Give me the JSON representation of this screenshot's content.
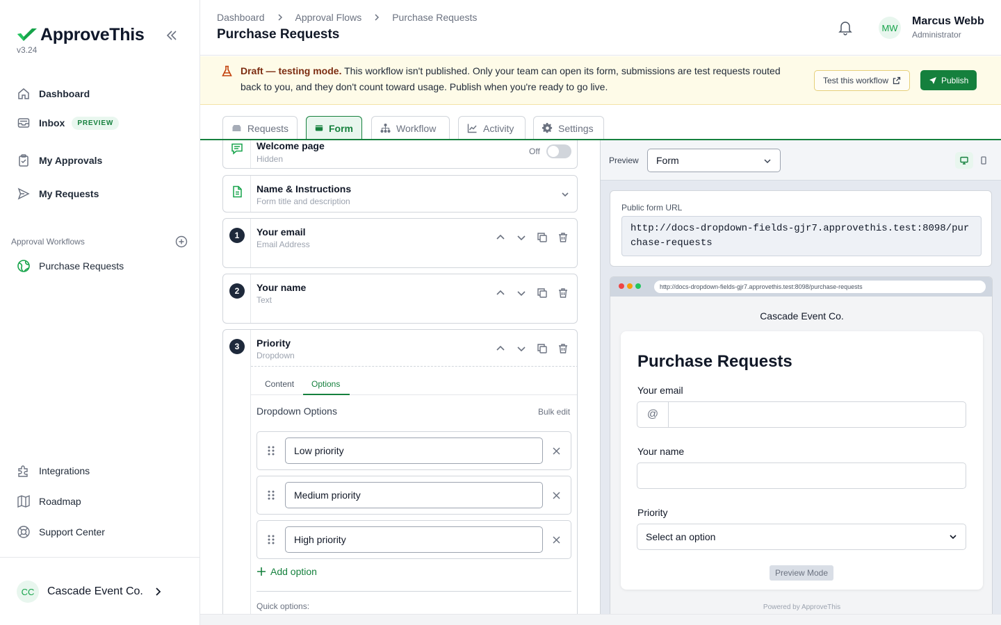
{
  "app": {
    "name": "ApproveThis",
    "version": "v3.24",
    "brand_color": "#15803d"
  },
  "sidebar": {
    "nav": [
      {
        "label": "Dashboard",
        "icon": "home-icon"
      },
      {
        "label": "Inbox",
        "icon": "inbox-icon",
        "badge": "PREVIEW"
      },
      {
        "label": "My Approvals",
        "icon": "clipboard-icon"
      },
      {
        "label": "My Requests",
        "icon": "send-icon"
      }
    ],
    "section_label": "Approval Workflows",
    "workflows": [
      {
        "label": "Purchase Requests",
        "icon": "globe-icon"
      }
    ],
    "bottom_nav": [
      {
        "label": "Integrations",
        "icon": "puzzle-icon"
      },
      {
        "label": "Roadmap",
        "icon": "map-icon"
      },
      {
        "label": "Support Center",
        "icon": "lifebuoy-icon"
      }
    ],
    "org": {
      "initials": "CC",
      "name": "Cascade Event Co."
    }
  },
  "header": {
    "breadcrumbs": [
      "Dashboard",
      "Approval Flows",
      "Purchase Requests"
    ],
    "title": "Purchase Requests",
    "user": {
      "initials": "MW",
      "name": "Marcus Webb",
      "role": "Administrator"
    }
  },
  "banner": {
    "strong": "Draft — testing mode.",
    "text": " This workflow isn't published. Only your team can open its form, submissions are test requests routed back to you, and they don't count toward usage. Publish when you're ready to go live.",
    "test_button": "Test this workflow",
    "publish_button": "Publish"
  },
  "tabs": [
    {
      "label": "Requests",
      "icon": "inbox-tray-icon"
    },
    {
      "label": "Form",
      "icon": "form-icon",
      "active": true
    },
    {
      "label": "Workflow",
      "icon": "workflow-icon"
    },
    {
      "label": "Activity",
      "icon": "chart-line-icon"
    },
    {
      "label": "Settings",
      "icon": "gear-icon"
    }
  ],
  "editor": {
    "welcome": {
      "title": "Welcome page",
      "sub": "Hidden",
      "toggle_label": "Off"
    },
    "name_instructions": {
      "title": "Name & Instructions",
      "sub": "Form title and description"
    },
    "fields": [
      {
        "num": "1",
        "title": "Your email",
        "type": "Email Address"
      },
      {
        "num": "2",
        "title": "Your name",
        "type": "Text"
      },
      {
        "num": "3",
        "title": "Priority",
        "type": "Dropdown"
      }
    ],
    "subtabs": [
      "Content",
      "Options"
    ],
    "dropdown_title": "Dropdown Options",
    "bulk_edit": "Bulk edit",
    "options": [
      "Low priority",
      "Medium priority",
      "High priority"
    ],
    "add_option": "Add option",
    "quick_options": "Quick options:"
  },
  "preview": {
    "label": "Preview",
    "mode": "Form",
    "public_url_label": "Public form URL",
    "public_url": "http://docs-dropdown-fields-gjr7.approvethis.test:8098/purchase-requests",
    "browser_url": "http://docs-dropdown-fields-gjr7.approvethis.test:8098/purchase-requests",
    "company": "Cascade Event Co.",
    "form_title": "Purchase Requests",
    "email_label": "Your email",
    "name_label": "Your name",
    "priority_label": "Priority",
    "priority_placeholder": "Select an option",
    "preview_mode": "Preview Mode",
    "powered_by": "Powered by ApproveThis"
  }
}
